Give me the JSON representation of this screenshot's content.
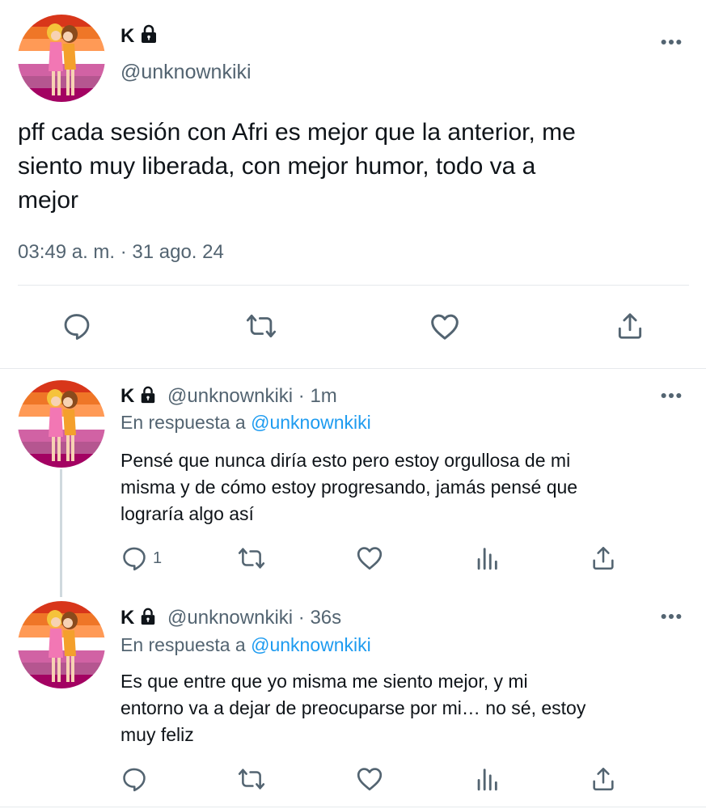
{
  "main_tweet": {
    "display_name": "K",
    "handle": "@unknownkiki",
    "text_lines": [
      "pff cada sesión con Afri es mejor que la anterior, me",
      "siento muy liberada, con mejor humor, todo va a",
      "mejor"
    ],
    "timestamp": "03:49 a. m. · 31 ago. 24",
    "actions": [
      "reply-icon",
      "retweet-icon",
      "like-icon",
      "share-icon"
    ]
  },
  "replies": [
    {
      "display_name": "K",
      "handle": "@unknownkiki",
      "time": "· 1m",
      "reply_prefix": "En respuesta a",
      "reply_target": "@unknownkiki",
      "text_lines": [
        "Pensé que nunca diría esto pero estoy orgullosa de mi",
        "misma y de cómo estoy progresando, jamás pensé que",
        "lograría algo así"
      ],
      "reply_count": "1"
    },
    {
      "display_name": "K",
      "handle": "@unknownkiki",
      "time": "· 36s",
      "reply_prefix": "En respuesta a",
      "reply_target": "@unknownkiki",
      "text_lines": [
        "Es que entre que yo misma me siento mejor, y mi",
        "entorno va a dejar de preocuparse por mi… no sé, estoy",
        "muy feliz"
      ],
      "reply_count": ""
    }
  ],
  "colors": {
    "text": "#0f1419",
    "secondary": "#536471",
    "link": "#1d9bf0",
    "divider": "#e6e9ec",
    "flag_stripes": [
      "#d52d00",
      "#ef7627",
      "#ff9a56",
      "#ffffff",
      "#d162a4",
      "#b55690",
      "#a30262"
    ]
  }
}
